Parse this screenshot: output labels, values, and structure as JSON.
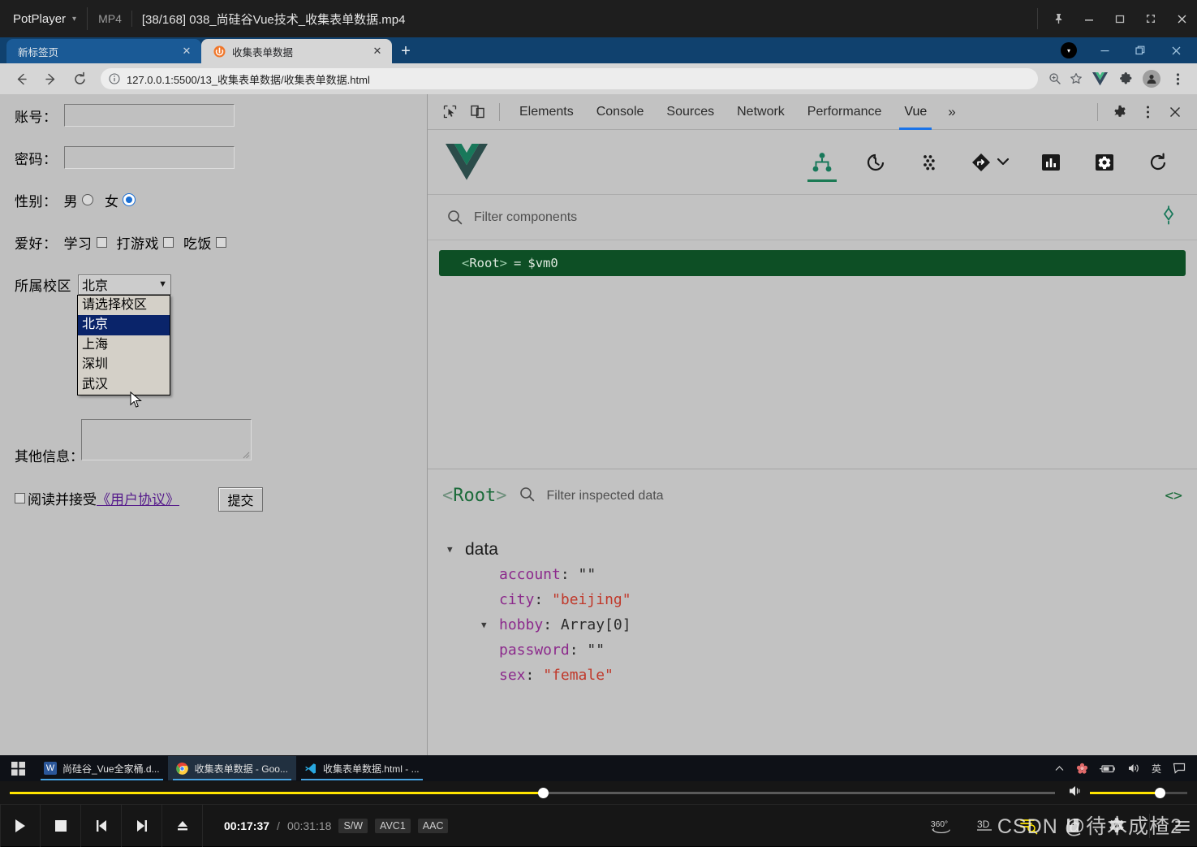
{
  "potplayer": {
    "app_name": "PotPlayer",
    "format": "MP4",
    "file_title": "[38/168] 038_尚硅谷Vue技术_收集表单数据.mp4",
    "window_buttons": [
      "pin-icon",
      "minimize-icon",
      "maximize-icon",
      "fullscreen-icon",
      "close-icon"
    ],
    "time_current": "00:17:37",
    "time_separator": "/",
    "time_total": "00:31:18",
    "chips": [
      "S/W",
      "AVC1",
      "AAC"
    ],
    "progress_percent": 51,
    "volume_percent": 72,
    "right_controls": [
      "360-button",
      "3D-button",
      "playlist-button",
      "bookmark-button",
      "settings-button",
      "menu-button"
    ],
    "labels": {
      "deg360": "360",
      "d3": "3D"
    },
    "watermark": "CSDN @待木成楂2"
  },
  "browser": {
    "tabs": [
      {
        "title": "新标签页",
        "active": false,
        "favicon": "none"
      },
      {
        "title": "收集表单数据",
        "active": true,
        "favicon": "live-server-icon"
      }
    ],
    "new_tab_label": "+",
    "window_buttons": [
      "minimize-icon",
      "restore-icon",
      "close-icon"
    ],
    "nav": {
      "back": "back-icon",
      "forward": "forward-icon",
      "reload": "reload-icon"
    },
    "omnibox": {
      "info_icon": "info-circle-icon",
      "url": "127.0.0.1:5500/13_收集表单数据/收集表单数据.html",
      "zoom_icon": "zoom-in-icon",
      "bookmark_icon": "star-icon"
    },
    "toolbar_icons": [
      "vue-devtools-icon",
      "extensions-puzzle-icon",
      "profile-avatar-icon",
      "chrome-menu-icon"
    ]
  },
  "form": {
    "account": {
      "label": "账号：",
      "value": "",
      "placeholder": ""
    },
    "password": {
      "label": "密码：",
      "value": "",
      "placeholder": ""
    },
    "sex": {
      "label": "性别：",
      "options": [
        {
          "label": "男",
          "checked": false
        },
        {
          "label": "女",
          "checked": true
        }
      ]
    },
    "hobby": {
      "label": "爱好：",
      "options": [
        {
          "label": "学习",
          "checked": false
        },
        {
          "label": "打游戏",
          "checked": false
        },
        {
          "label": "吃饭",
          "checked": false
        }
      ]
    },
    "campus": {
      "label": "所属校区",
      "selected": "北京",
      "open": true,
      "options": [
        {
          "label": "请选择校区",
          "selected": false
        },
        {
          "label": "北京",
          "selected": true
        },
        {
          "label": "上海",
          "selected": false
        },
        {
          "label": "深圳",
          "selected": false
        },
        {
          "label": "武汉",
          "selected": false
        }
      ]
    },
    "other": {
      "label": "其他信息：",
      "value": ""
    },
    "agree": {
      "checked": false,
      "text": "阅读并接受",
      "link_text": "《用户协议》"
    },
    "submit": {
      "label": "提交"
    }
  },
  "devtools": {
    "left_icons": [
      "inspect-element-icon",
      "device-toolbar-icon"
    ],
    "tabs": [
      {
        "label": "Elements",
        "active": false
      },
      {
        "label": "Console",
        "active": false
      },
      {
        "label": "Sources",
        "active": false
      },
      {
        "label": "Network",
        "active": false
      },
      {
        "label": "Performance",
        "active": false
      },
      {
        "label": "Vue",
        "active": true
      }
    ],
    "more_tabs": "»",
    "right_icons": [
      "settings-gear-icon",
      "devtools-menu-icon",
      "close-devtools-icon"
    ]
  },
  "vue_panel": {
    "logo": "vue-logo-icon",
    "toolbar": [
      {
        "name": "components-tree-icon",
        "active": true
      },
      {
        "name": "timeline-history-icon",
        "active": false
      },
      {
        "name": "vuex-icon",
        "active": false
      },
      {
        "name": "routes-icon",
        "active": false
      },
      {
        "name": "chevron-down-icon",
        "active": false
      },
      {
        "name": "performance-bars-icon",
        "active": false
      },
      {
        "name": "settings-gear-icon",
        "active": false
      },
      {
        "name": "refresh-icon",
        "active": false
      }
    ],
    "filter_placeholder": "Filter components",
    "target-icon": "select-component-icon",
    "tree": [
      {
        "name": "Root",
        "instance": "$vm0",
        "selected": true
      }
    ],
    "inspector": {
      "component": "Root",
      "filter_placeholder": "Filter inspected data",
      "open_in_editor_icon": "code-brackets-icon",
      "sections": [
        {
          "title": "data",
          "expanded": true,
          "entries": [
            {
              "key": "account",
              "value": "\"\"",
              "kind": "string",
              "expandable": false
            },
            {
              "key": "city",
              "value": "\"beijing\"",
              "kind": "string",
              "expandable": false
            },
            {
              "key": "hobby",
              "value": "Array[0]",
              "kind": "array",
              "expandable": true
            },
            {
              "key": "password",
              "value": "\"\"",
              "kind": "string",
              "expandable": false
            },
            {
              "key": "sex",
              "value": "\"female\"",
              "kind": "string",
              "expandable": false
            }
          ]
        }
      ]
    }
  },
  "taskbar": {
    "start": "windows-start-icon",
    "items": [
      {
        "label": "尚硅谷_Vue全家桶.d...",
        "icon": "word-icon",
        "active": false
      },
      {
        "label": "收集表单数据 - Goo...",
        "icon": "chrome-icon",
        "active": true
      },
      {
        "label": "收集表单数据.html - ...",
        "icon": "vscode-icon",
        "active": false
      }
    ],
    "tray": [
      "chevron-up-icon",
      "flower-icon",
      "battery-icon",
      "volume-icon",
      "ime-english-icon",
      "notifications-icon"
    ],
    "tray_ime_label": "英"
  },
  "colors": {
    "potplayer_bg": "#1e1e1e",
    "chrome_tabstrip": "#10416e",
    "page_bg": "#c0c0c0",
    "devtools_bg": "#c2c2c2",
    "vue_green": "#1b7a54",
    "tree_selected": "#0d4f25",
    "accent_blue": "#1a73e8",
    "option_selected": "#0a246a",
    "seek_yellow": "#ffe400",
    "string_red": "#c0392b",
    "key_purple": "#8c2a8c"
  }
}
